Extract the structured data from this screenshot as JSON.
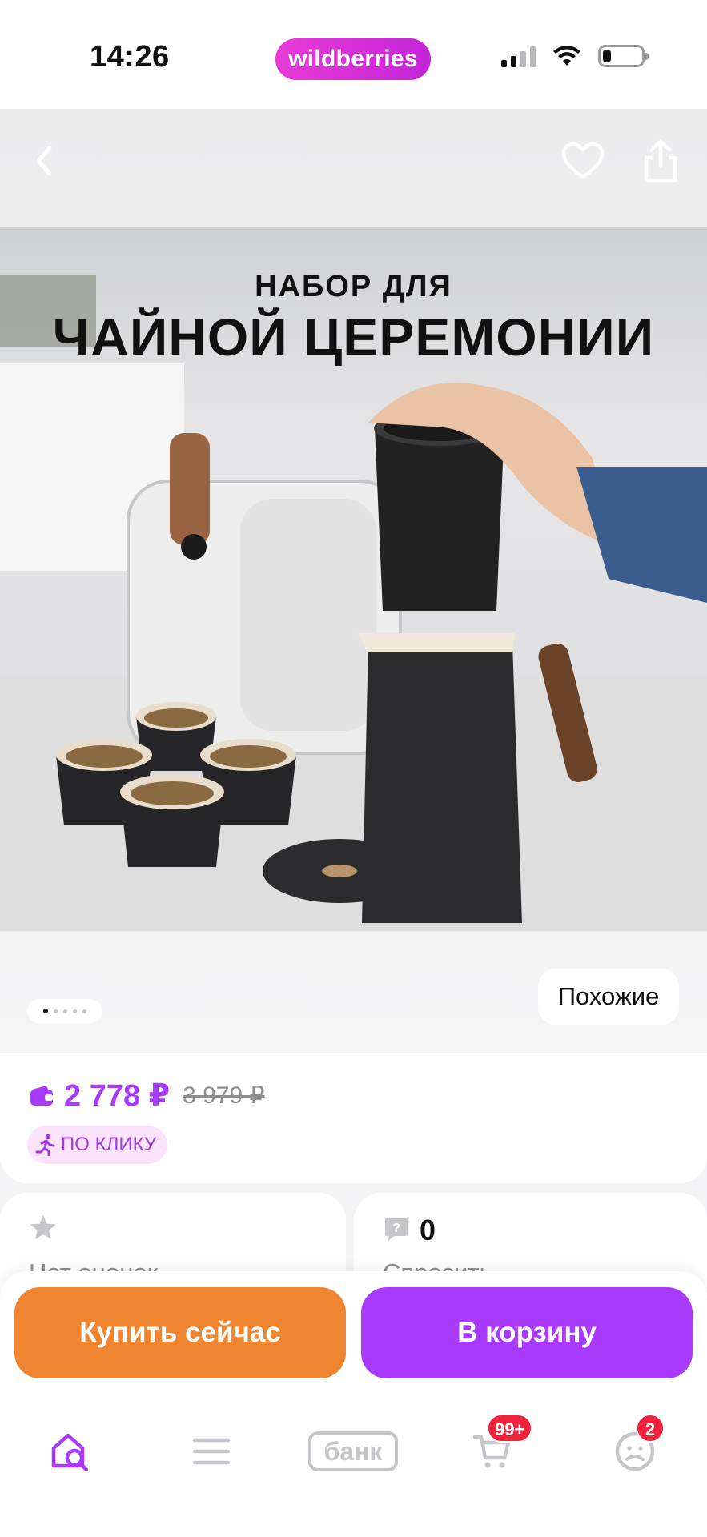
{
  "status_bar": {
    "time": "14:26",
    "brand": "wildberries"
  },
  "product": {
    "image_text_line1": "НАБОР ДЛЯ",
    "image_text_line2": "ЧАЙНОЙ ЦЕРЕМОНИИ",
    "image_count": 5,
    "current_image": 1,
    "similar_label": "Похожие",
    "price": "2 778 ₽",
    "old_price": "3 979 ₽",
    "click_badge": "ПО КЛИКУ"
  },
  "rating": {
    "label": "Нет оценок"
  },
  "questions": {
    "count": "0",
    "label": "Спросить"
  },
  "actions": {
    "buy_now": "Купить сейчас",
    "add_to_cart": "В корзину"
  },
  "tabbar": {
    "bank_label": "банк",
    "cart_badge": "99+",
    "profile_badge": "2"
  },
  "colors": {
    "accent_purple": "#a73afd",
    "buy_orange": "#ef8530",
    "badge_red": "#f0223c",
    "brand_pink": "#e93bd7"
  },
  "icons": [
    "back-arrow-icon",
    "heart-icon",
    "share-icon",
    "wallet-icon",
    "running-man-icon",
    "star-icon",
    "question-bubble-icon",
    "home-search-icon",
    "menu-icon",
    "cart-icon",
    "profile-icon"
  ]
}
